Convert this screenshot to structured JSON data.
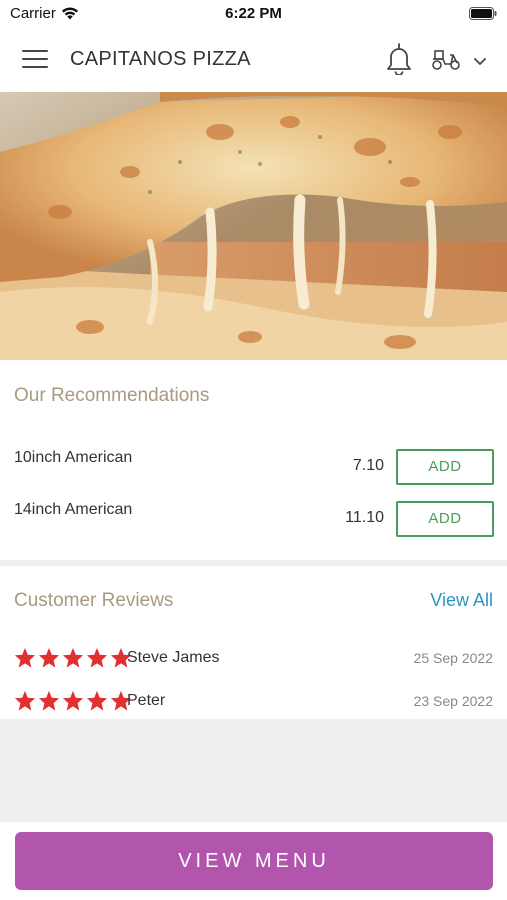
{
  "status_bar": {
    "carrier": "Carrier",
    "time": "6:22 PM"
  },
  "header": {
    "title": "CAPITANOS PIZZA",
    "icons": [
      "hamburger-menu-icon",
      "bell-icon",
      "scooter-icon",
      "chevron-down-icon"
    ]
  },
  "hero": {
    "image": "melting-cheese-pizza-slice"
  },
  "recommendations": {
    "title": "Our Recommendations",
    "items": [
      {
        "name": "10inch American",
        "price": "7.10",
        "button": "ADD"
      },
      {
        "name": "14inch American",
        "price": "11.10",
        "button": "ADD"
      }
    ]
  },
  "reviews": {
    "title": "Customer Reviews",
    "view_all": "View All",
    "items": [
      {
        "rating": 5,
        "name": "Steve James",
        "date": "25 Sep 2022"
      },
      {
        "rating": 5,
        "name": "Peter",
        "date": "23 Sep 2022"
      }
    ]
  },
  "footer": {
    "button": "VIEW MENU"
  },
  "colors": {
    "accent_purple": "#b255ad",
    "add_green": "#4a9e5c",
    "link_blue": "#2a95c4",
    "section_title": "#a89a80",
    "star_red": "#e03030"
  }
}
